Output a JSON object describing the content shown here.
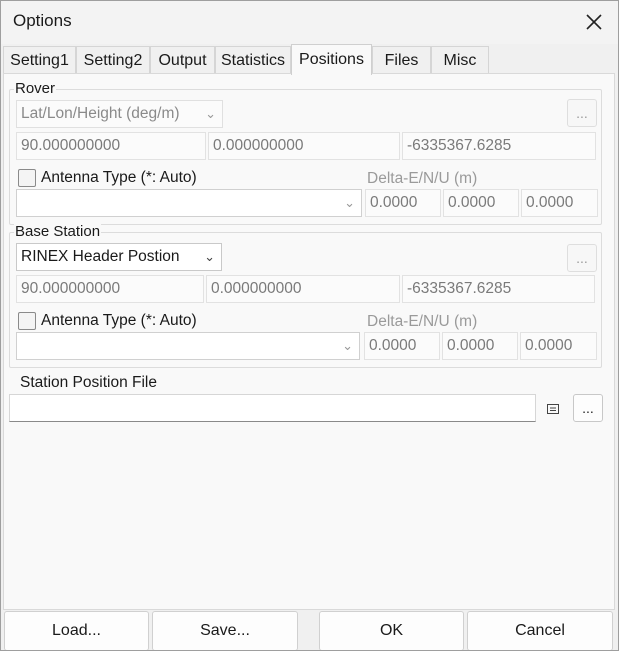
{
  "window": {
    "title": "Options"
  },
  "tabs": [
    "Setting1",
    "Setting2",
    "Output",
    "Statistics",
    "Positions",
    "Files",
    "Misc"
  ],
  "rover": {
    "label": "Rover",
    "format": "Lat/Lon/Height (deg/m)",
    "lat": "90.000000000",
    "lon": "0.000000000",
    "height": "-6335367.6285",
    "antenna_label": "Antenna Type (*: Auto)",
    "delta_label": "Delta-E/N/U (m)",
    "antenna_value": "",
    "delta_e": "0.0000",
    "delta_n": "0.0000",
    "delta_u": "0.0000"
  },
  "base": {
    "label": "Base Station",
    "format": "RINEX Header Postion",
    "lat": "90.000000000",
    "lon": "0.000000000",
    "height": "-6335367.6285",
    "antenna_label": "Antenna Type (*: Auto)",
    "delta_label": "Delta-E/N/U (m)",
    "antenna_value": "",
    "delta_e": "0.0000",
    "delta_n": "0.0000",
    "delta_u": "0.0000"
  },
  "station_file": {
    "label": "Station Position File",
    "value": ""
  },
  "ellipsis": "...",
  "footer": {
    "load": "Load...",
    "save": "Save...",
    "ok": "OK",
    "cancel": "Cancel"
  }
}
